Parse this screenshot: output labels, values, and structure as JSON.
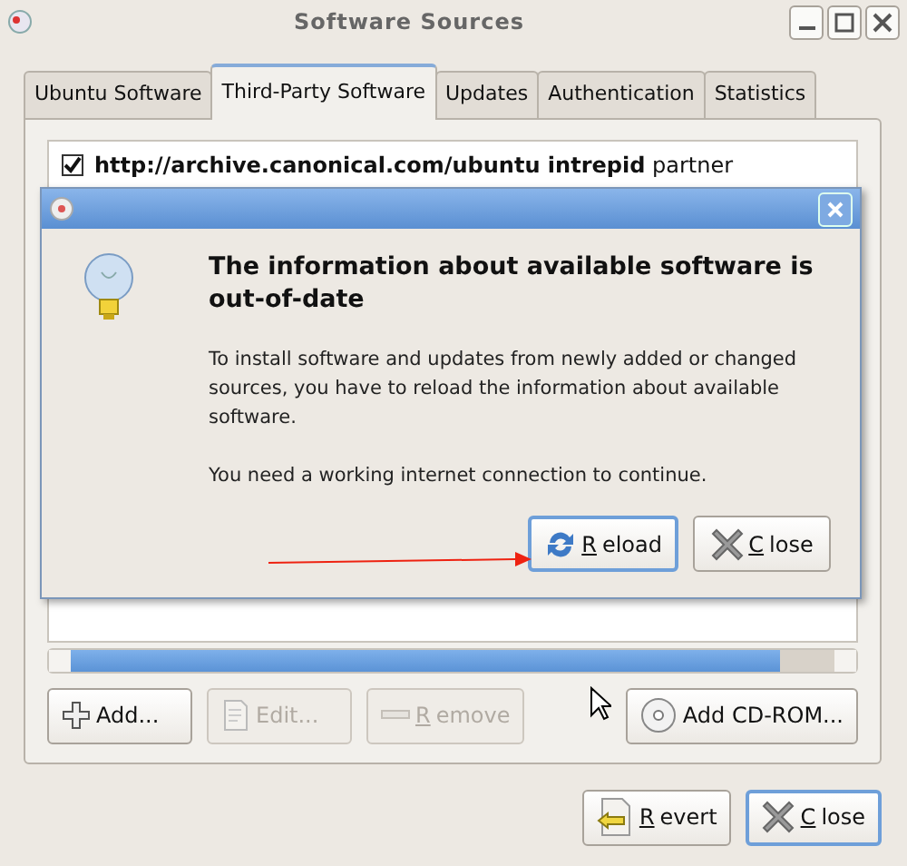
{
  "window": {
    "title": "Software Sources"
  },
  "tabs": [
    {
      "label": "Ubuntu Software",
      "selected": false
    },
    {
      "label": "Third-Party Software",
      "selected": true
    },
    {
      "label": "Updates",
      "selected": false
    },
    {
      "label": "Authentication",
      "selected": false
    },
    {
      "label": "Statistics",
      "selected": false
    }
  ],
  "sources": [
    {
      "checked": true,
      "url": "http://archive.canonical.com/ubuntu intrepid",
      "components": "partner"
    }
  ],
  "source_buttons": [
    {
      "label": "Add...",
      "disabled": false,
      "mnemonic": false
    },
    {
      "label": "Edit...",
      "disabled": true,
      "mnemonic": false
    },
    {
      "label": "Remove",
      "disabled": true,
      "mnemonic": true
    },
    {
      "label": "Add CD-ROM...",
      "disabled": false,
      "mnemonic": false
    }
  ],
  "window_buttons": [
    {
      "label": "Revert",
      "focused": false,
      "mnemonic": true
    },
    {
      "label": "Close",
      "focused": true,
      "mnemonic": true
    }
  ],
  "dialog": {
    "heading": "The information about available software is out-of-date",
    "message": "To install software and updates from newly added or changed sources, you have to reload the information about available software.",
    "note": "You need a working internet connection to continue.",
    "buttons": [
      {
        "label": "Reload",
        "focused": true,
        "mnemonic": true
      },
      {
        "label": "Close",
        "focused": false,
        "mnemonic": true
      }
    ]
  }
}
